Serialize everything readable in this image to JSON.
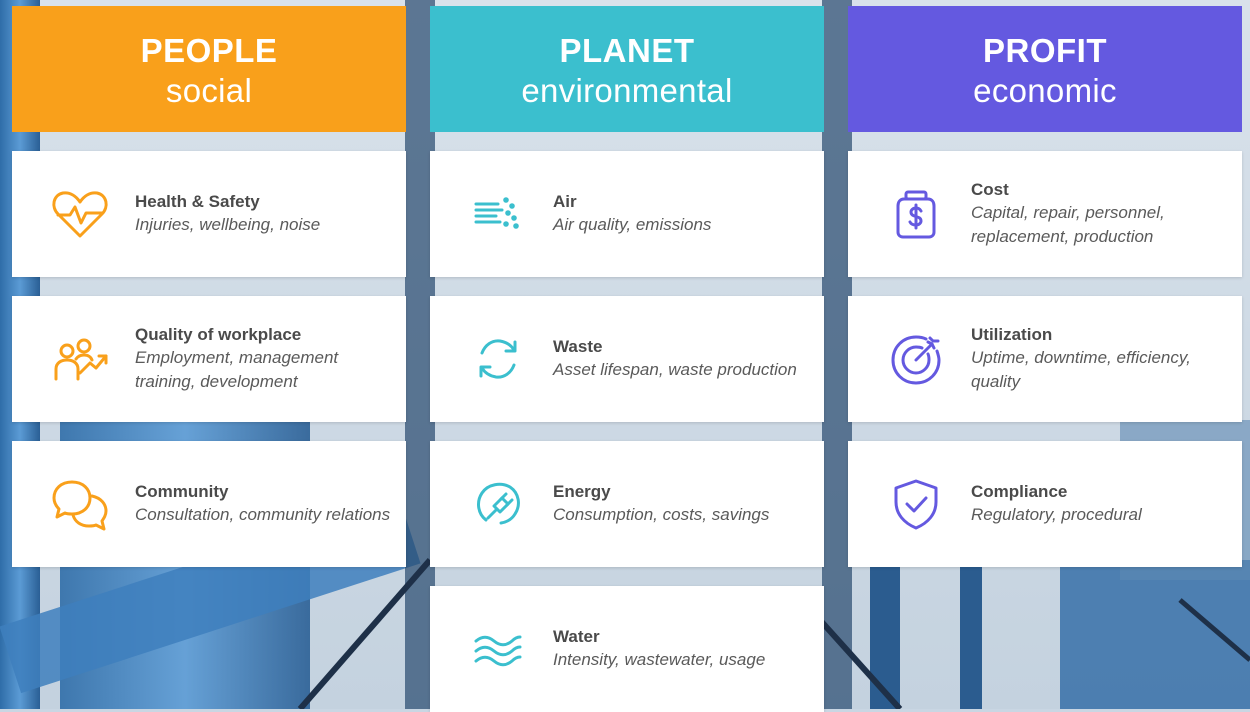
{
  "colors": {
    "people": "#f9a01b",
    "planet": "#3bbfce",
    "profit": "#6459e0"
  },
  "columns": [
    {
      "title": "PEOPLE",
      "subtitle": "social",
      "items": [
        {
          "title": "Health & Safety",
          "desc": "Injuries, wellbeing, noise",
          "icon": "heart-pulse-icon"
        },
        {
          "title": "Quality of workplace",
          "desc": "Employment, management training, development",
          "icon": "people-growth-icon"
        },
        {
          "title": "Community",
          "desc": "Consultation, community relations",
          "icon": "chat-bubbles-icon"
        }
      ]
    },
    {
      "title": "PLANET",
      "subtitle": "environmental",
      "items": [
        {
          "title": "Air",
          "desc": "Air quality, emissions",
          "icon": "air-flow-icon"
        },
        {
          "title": "Waste",
          "desc": "Asset lifespan, waste production",
          "icon": "recycle-icon"
        },
        {
          "title": "Energy",
          "desc": "Consumption, costs, savings",
          "icon": "plug-icon"
        },
        {
          "title": "Water",
          "desc": "Intensity, wastewater, usage",
          "icon": "water-waves-icon"
        }
      ]
    },
    {
      "title": "PROFIT",
      "subtitle": "economic",
      "items": [
        {
          "title": "Cost",
          "desc": "Capital, repair, personnel, replacement, production",
          "icon": "money-jar-icon"
        },
        {
          "title": "Utilization",
          "desc": "Uptime, downtime, efficiency, quality",
          "icon": "target-icon"
        },
        {
          "title": "Compliance",
          "desc": "Regulatory, procedural",
          "icon": "shield-check-icon"
        }
      ]
    }
  ]
}
